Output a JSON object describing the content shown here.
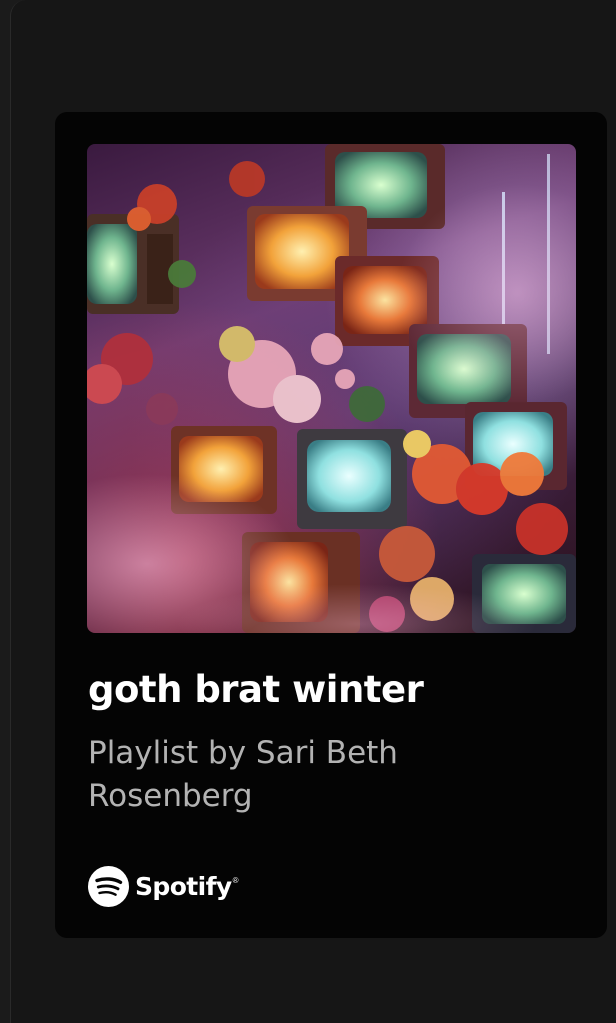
{
  "embed": {
    "playlist_title": "goth brat winter",
    "playlist_subtitle": "Playlist by Sari Beth Rosenberg",
    "brand": {
      "name": "Spotify",
      "trademark": "®",
      "logo_icon": "spotify-logo-icon"
    },
    "cover_image": {
      "content": "vintage tv sets stacked among flowers in purple haze"
    }
  },
  "colors": {
    "background": "#161616",
    "card": "#040404",
    "title": "#ffffff",
    "subtitle": "#b3b3b3"
  }
}
